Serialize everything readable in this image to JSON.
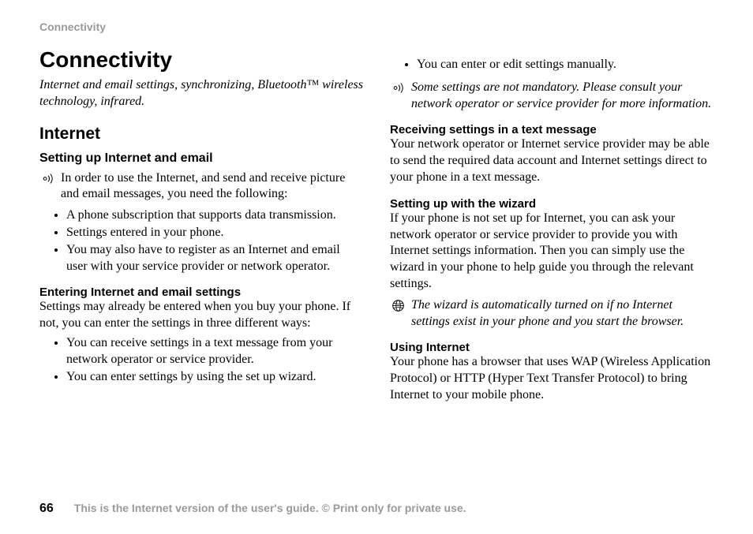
{
  "header": "Connectivity",
  "title": "Connectivity",
  "subtitle": "Internet and email settings, synchronizing, Bluetooth™ wireless technology, infrared.",
  "section_heading": "Internet",
  "sub1": {
    "heading": "Setting up Internet and email",
    "intro": "In order to use the Internet, and send and receive picture and email messages, you need the following:",
    "items": [
      "A phone subscription that supports data transmission.",
      "Settings entered in your phone.",
      "You may also have to register as an Internet and email user with your service provider or network operator."
    ]
  },
  "sub2": {
    "heading": "Entering Internet and email settings",
    "body": "Settings may already be entered when you buy your phone. If not, you can enter the settings in three different ways:",
    "items": [
      "You can receive settings in a text message from your network operator or service provider.",
      "You can enter settings by using the set up wizard.",
      "You can enter or edit settings manually."
    ]
  },
  "note1": "Some settings are not mandatory. Please consult your network operator or service provider for more information.",
  "sub3": {
    "heading": "Receiving settings in a text message",
    "body": "Your network operator or Internet service provider may be able to send the required data account and Internet settings direct to your phone in a text message."
  },
  "sub4": {
    "heading": "Setting up with the wizard",
    "body": "If your phone is not set up for Internet, you can ask your network operator or service provider to provide you with Internet settings information. Then you can simply use the wizard in your phone to help guide you through the relevant settings."
  },
  "note2": "The wizard is automatically turned on if no Internet settings exist in your phone and you start the browser.",
  "sub5": {
    "heading": "Using Internet",
    "body": "Your phone has a browser that uses WAP (Wireless Application Protocol) or HTTP (Hyper Text Transfer Protocol) to bring Internet to your mobile phone."
  },
  "footer": {
    "page": "66",
    "text": "This is the Internet version of the user's guide. © Print only for private use."
  }
}
